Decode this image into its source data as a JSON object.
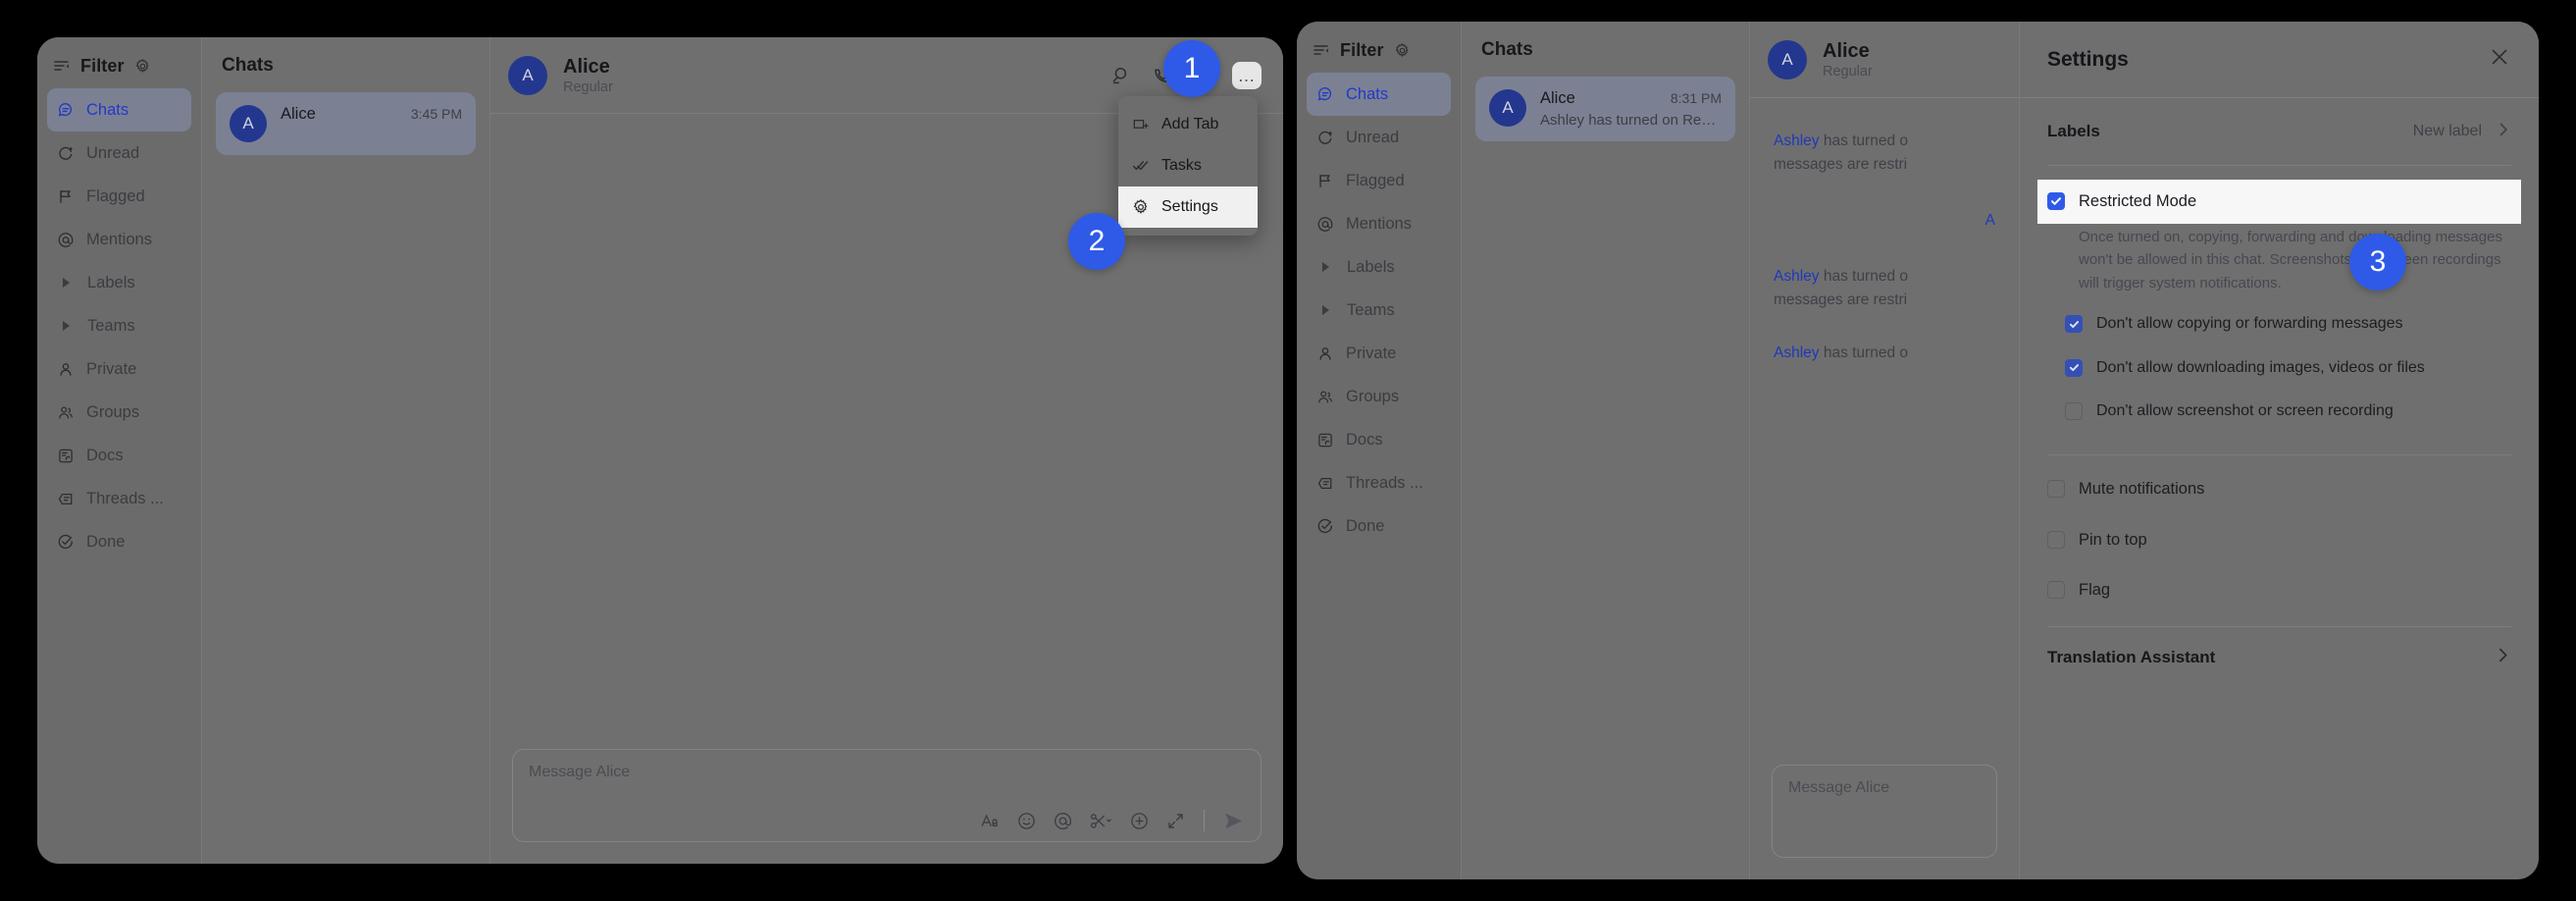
{
  "sidebar": {
    "filter_label": "Filter",
    "gear_icon": "gear-icon",
    "filter_icon": "filter-lines-icon",
    "items": [
      {
        "label": "Chats",
        "icon": "chat-bubble-icon",
        "active": true
      },
      {
        "label": "Unread",
        "icon": "unread-circle-icon",
        "active": false
      },
      {
        "label": "Flagged",
        "icon": "flag-icon",
        "active": false
      },
      {
        "label": "Mentions",
        "icon": "at-sign-icon",
        "active": false
      },
      {
        "label": "Labels",
        "icon": "caret-right-icon",
        "active": false
      },
      {
        "label": "Teams",
        "icon": "caret-right-icon",
        "active": false
      },
      {
        "label": "Private",
        "icon": "person-icon",
        "active": false
      },
      {
        "label": "Groups",
        "icon": "people-icon",
        "active": false
      },
      {
        "label": "Docs",
        "icon": "docs-icon",
        "active": false
      },
      {
        "label": "Threads ...",
        "icon": "threads-icon",
        "active": false
      },
      {
        "label": "Done",
        "icon": "check-circle-icon",
        "active": false
      }
    ]
  },
  "chat_list": {
    "title": "Chats",
    "window_left_item": {
      "avatar": "A",
      "name": "Alice",
      "time": "3:45 PM",
      "preview": ""
    },
    "window_right_item": {
      "avatar": "A",
      "name": "Alice",
      "time": "8:31 PM",
      "preview": "Ashley has turned on Restri..."
    }
  },
  "conversation": {
    "avatar": "A",
    "peer_name": "Alice",
    "peer_subtitle": "Regular",
    "header_icons": [
      "search-icon",
      "video-call-icon",
      "add-person-icon",
      "more-horizontal-icon"
    ],
    "more_glyph": "…",
    "system_messages": [
      {
        "who": "Ashley",
        "text": " has turned o"
      },
      {
        "tail": "messages are restri"
      },
      {
        "who": "Ashley",
        "text": " has turned o"
      },
      {
        "tail": "messages are restri"
      },
      {
        "who": "Ashley",
        "text": " has turned o"
      }
    ],
    "mid_fragment": "A"
  },
  "composer": {
    "placeholder": "Message Alice",
    "icons": [
      "format-text-icon",
      "emoji-icon",
      "mention-icon",
      "snippet-scissors-icon",
      "plus-circle-icon",
      "expand-icon",
      "send-icon"
    ]
  },
  "menu": {
    "items": [
      {
        "label": "Add Tab",
        "icon": "add-tab-icon",
        "highlighted": false
      },
      {
        "label": "Tasks",
        "icon": "tasks-icon",
        "highlighted": false
      },
      {
        "label": "Settings",
        "icon": "gear-icon",
        "highlighted": true
      }
    ]
  },
  "settings": {
    "title": "Settings",
    "close_icon": "close-icon",
    "labels_row": {
      "heading": "Labels",
      "action": "New label",
      "chevron": "chevron-right-icon"
    },
    "restricted": {
      "label": "Restricted Mode",
      "checked": true,
      "description": "Once turned on, copying, forwarding and downloading messages won't be allowed in this chat. Screenshots and screen recordings will trigger system notifications.",
      "sub_options": [
        {
          "label": "Don't allow copying or forwarding messages",
          "checked": true
        },
        {
          "label": "Don't allow downloading images, videos or files",
          "checked": true
        },
        {
          "label": "Don't allow screenshot or screen recording",
          "checked": false
        }
      ]
    },
    "toggles": [
      {
        "label": "Mute notifications",
        "checked": false
      },
      {
        "label": "Pin to top",
        "checked": false
      },
      {
        "label": "Flag",
        "checked": false
      }
    ],
    "translation_row": {
      "heading": "Translation Assistant",
      "chevron": "chevron-right-icon"
    }
  },
  "badges": [
    {
      "number": "1"
    },
    {
      "number": "2"
    },
    {
      "number": "3"
    }
  ],
  "colors": {
    "accent_blue": "#2f5ae8",
    "link_blue": "#1f39b8",
    "avatar_blue": "#23378f",
    "window_bg": "#6f6f6f",
    "active_item_bg": "#7b8193",
    "page_bg": "#000000"
  }
}
